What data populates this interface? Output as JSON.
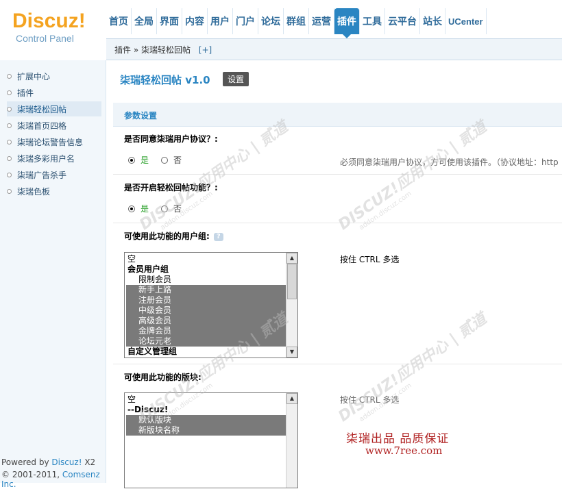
{
  "logo": {
    "main": "Discuz!",
    "sub": "Control Panel"
  },
  "nav": [
    {
      "label": "首页"
    },
    {
      "label": "全局"
    },
    {
      "label": "界面"
    },
    {
      "label": "内容"
    },
    {
      "label": "用户"
    },
    {
      "label": "门户"
    },
    {
      "label": "论坛"
    },
    {
      "label": "群组"
    },
    {
      "label": "运营"
    },
    {
      "label": "插件",
      "active": true
    },
    {
      "label": "工具"
    },
    {
      "label": "云平台"
    },
    {
      "label": "站长"
    },
    {
      "label": "UCenter"
    }
  ],
  "breadcrumb": {
    "text": "插件 » 柒瑞轻松回帖",
    "plus": "[+]"
  },
  "sidebar": {
    "items": [
      {
        "label": "扩展中心"
      },
      {
        "label": "插件"
      },
      {
        "label": "柒瑞轻松回帖",
        "active": true
      },
      {
        "label": "柒瑞首页四格"
      },
      {
        "label": "柒瑞论坛警告信息"
      },
      {
        "label": "柒瑞多彩用户名"
      },
      {
        "label": "柒瑞广告杀手"
      },
      {
        "label": "柒瑞色板"
      }
    ],
    "powered_prefix": "Powered by ",
    "powered_link": "Discuz!",
    "powered_suffix": " X2",
    "copyright_prefix": "© 2001-2011, ",
    "copyright_link": "Comsenz Inc."
  },
  "main": {
    "title": "柒瑞轻松回帖 v1.0",
    "setting_button": "设置",
    "section_title": "参数设置",
    "q1": {
      "label": "是否同意柒瑞用户协议？:",
      "yes": "是",
      "no": "否",
      "selected": "yes",
      "tip": "必须同意柒瑞用户协议，方可使用该插件。（协议地址：http"
    },
    "q2": {
      "label": "是否开启轻松回帖功能？:",
      "yes": "是",
      "no": "否",
      "selected": "yes"
    },
    "q3": {
      "label": "可使用此功能的用户组:",
      "tip": "按住 CTRL 多选",
      "options": [
        {
          "text": "空",
          "type": "plain"
        },
        {
          "text": "会员用户组",
          "type": "group"
        },
        {
          "text": "限制会员",
          "type": "child"
        },
        {
          "text": "新手上路",
          "type": "child",
          "selected": true
        },
        {
          "text": "注册会员",
          "type": "child",
          "selected": true
        },
        {
          "text": "中级会员",
          "type": "child",
          "selected": true
        },
        {
          "text": "高级会员",
          "type": "child",
          "selected": true
        },
        {
          "text": "金牌会员",
          "type": "child",
          "selected": true
        },
        {
          "text": "论坛元老",
          "type": "child",
          "selected": true
        },
        {
          "text": "自定义管理组",
          "type": "group"
        }
      ]
    },
    "q4": {
      "label": "可使用此功能的版块:",
      "tip": "按住 CTRL 多选",
      "options": [
        {
          "text": "空",
          "type": "plain"
        },
        {
          "text": "--Discuz!",
          "type": "group"
        },
        {
          "text": "默认版块",
          "type": "child",
          "selected": true
        },
        {
          "text": "新版块名称",
          "type": "child",
          "selected": true
        }
      ]
    },
    "promo_line1": "柒瑞出品  品质保证",
    "promo_line2": "www.7ree.com"
  },
  "watermark": {
    "big": "DISCUZ!应用中心 | 贰道",
    "small": "addon.discuz.com"
  },
  "colors": {
    "accent": "#2a85c2",
    "logo": "#f4a320",
    "promo": "#b02020"
  }
}
